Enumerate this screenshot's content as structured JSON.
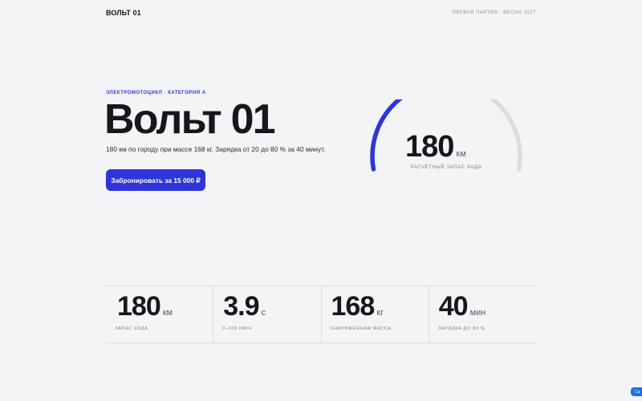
{
  "header": {
    "brand": "ВОЛЬТ 01",
    "batch": "ПЕРВАЯ ПАРТИЯ · ВЕСНА 2027"
  },
  "hero": {
    "eyebrow": "ЭЛЕКТРОМОТОЦИКЛ · КАТЕГОРИЯ A",
    "title": "Вольт 01",
    "description": "180 км по городу при массе 168 кг. Зарядка от 20 до 80 % за 40 минут.",
    "cta_label": "Забронировать за 15 000 ₽"
  },
  "gauge": {
    "value": "180",
    "unit": "км",
    "caption": "РАСЧЁТНЫЙ ЗАПАС ХОДА",
    "fill_fraction": 0.6,
    "colors": {
      "fill": "#2e35d9",
      "track": "#dcdde1"
    }
  },
  "stats": [
    {
      "value": "180",
      "unit": "км",
      "label": "ЗАПАС ХОДА"
    },
    {
      "value": "3.9",
      "unit": "с",
      "label": "0–100 КМ/Ч"
    },
    {
      "value": "168",
      "unit": "кг",
      "label": "СНАРЯЖЁННАЯ МАССА"
    },
    {
      "value": "40",
      "unit": "мин",
      "label": "ЗАРЯДКА ДО 80 %"
    }
  ],
  "floating_button": {
    "label": "Ca"
  },
  "colors": {
    "accent": "#2e35d9",
    "background": "#f3f4f6",
    "text": "#16171d"
  }
}
